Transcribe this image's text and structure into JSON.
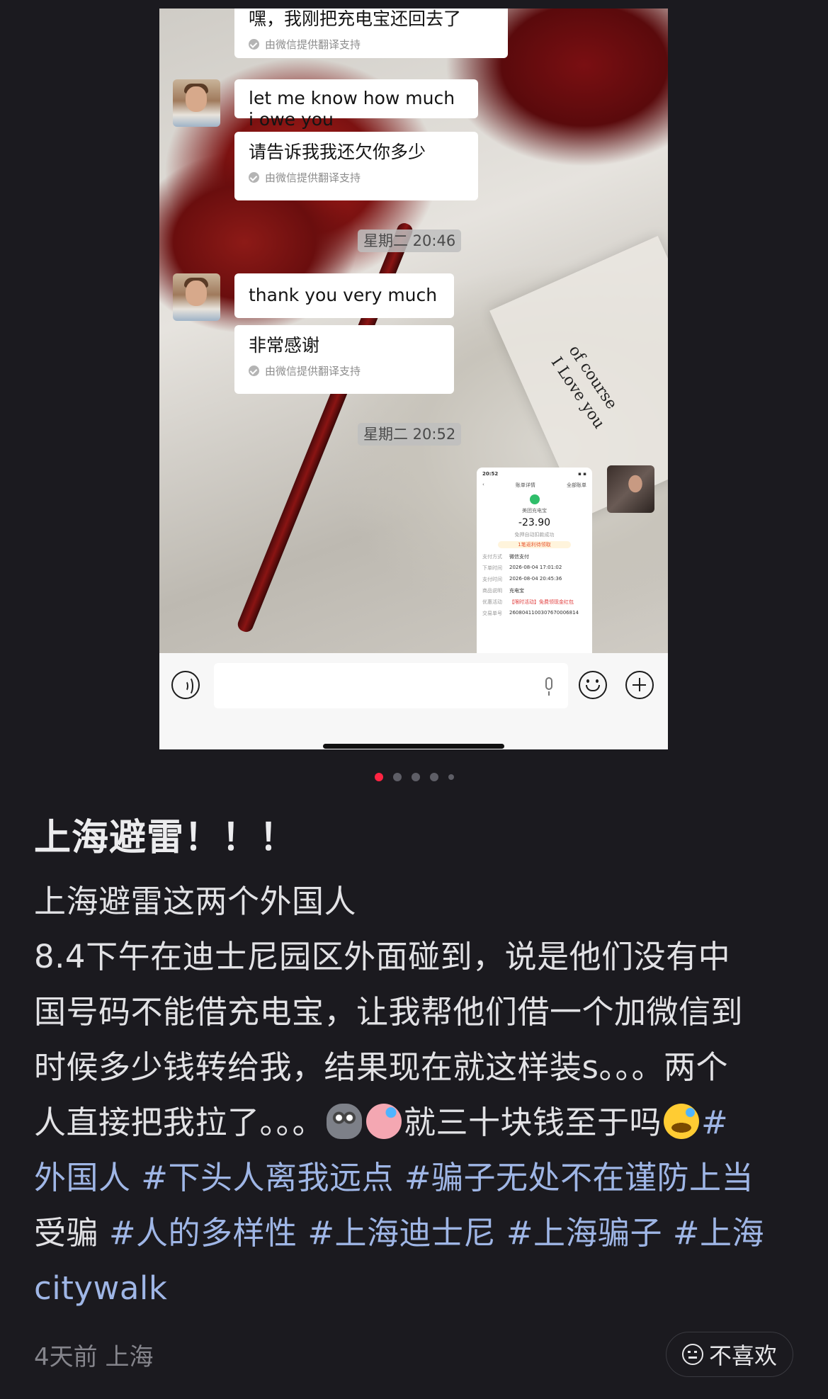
{
  "chat": {
    "msg_top_partial": "嘿，我刚把充电宝还回去了",
    "translate_note": "由微信提供翻译支持",
    "msg1_en": "let me know how much i owe you",
    "msg1_zh": "请告诉我我还欠你多少",
    "time1": "星期二 20:46",
    "msg2_en": "thank you very much",
    "msg2_zh": "非常感谢",
    "time2": "星期二 20:52",
    "card_text_line1": "of course",
    "card_text_line2": "I Love you"
  },
  "receipt": {
    "status_time": "20:52",
    "title": "账单详情",
    "link": "全部账单",
    "merchant": "美团充电宝",
    "amount": "-23.90",
    "status": "免押自动扣款成功",
    "promo": "1笔返利待领取",
    "rows": [
      {
        "k": "支付方式",
        "v": "微信支付"
      },
      {
        "k": "下单时间",
        "v": "2026-08-04 17:01:02"
      },
      {
        "k": "支付时间",
        "v": "2026-08-04 20:45:36"
      },
      {
        "k": "商品说明",
        "v": "充电宝"
      },
      {
        "k": "优惠活动",
        "v": "【限时活动】免费领现金红包"
      },
      {
        "k": "交易单号",
        "v": "2608041100307670006814"
      }
    ]
  },
  "pagination": {
    "total": 5,
    "current": 1
  },
  "post": {
    "title": "上海避雷！！！",
    "body_lines": [
      "上海避雷这两个外国人",
      "8.4下午在迪士尼园区外面碰到，说是他们没有中",
      "国号码不能借充电宝，让我帮他们借一个加微信到",
      "时候多少钱转给我，结果现在就这样装s。。。两个"
    ],
    "line5_a": "人直接把我拉了。。。",
    "line5_b": "就三十块钱至于吗",
    "line5_tag": "#",
    "line6_a": "外国人 #下头人离我远点 #骗子无处不在谨防上当",
    "line7": "受骗 #人的多样性 #上海迪士尼 #上海骗子 #上海",
    "line8": "citywalk",
    "meta": "4天前 上海",
    "dislike_label": "不喜欢"
  },
  "colors": {
    "background": "#1b1a1f",
    "accent_dot": "#ff2442",
    "hashtag": "#9fb6e6"
  }
}
